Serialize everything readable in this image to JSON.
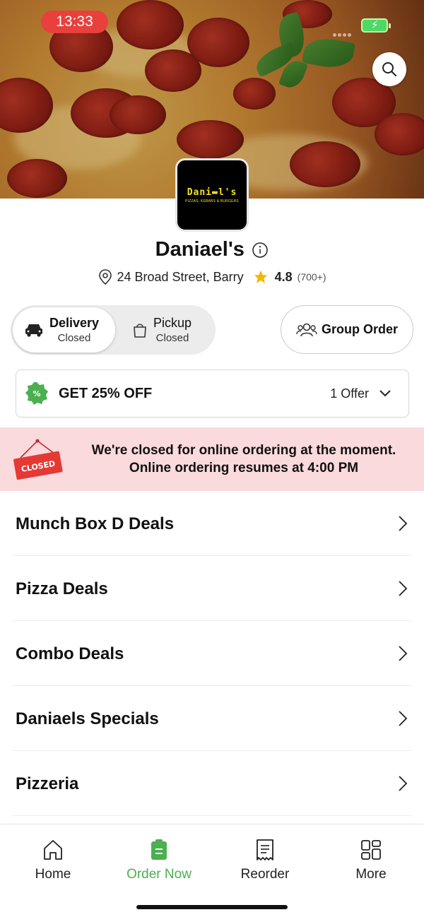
{
  "status_bar": {
    "time": "13:33",
    "battery_icon": "battery-charging-icon"
  },
  "hero": {
    "search_icon": "search-icon"
  },
  "restaurant": {
    "logo_name": "Dani▬l's",
    "logo_tagline": "PIZZAS, KEBABS & BURGERS",
    "name": "Daniael's",
    "address": "24 Broad Street, Barry",
    "rating": "4.8",
    "review_count": "(700+)"
  },
  "fulfillment": {
    "delivery": {
      "label": "Delivery",
      "status": "Closed",
      "selected": true
    },
    "pickup": {
      "label": "Pickup",
      "status": "Closed",
      "selected": false
    }
  },
  "group_order": {
    "label": "Group Order"
  },
  "offer": {
    "title": "GET 25% OFF",
    "count_label": "1 Offer"
  },
  "closed_notice": {
    "sign_text": "CLOSED",
    "line1": "We're closed for online ordering at the moment.",
    "line2": "Online ordering resumes at 4:00 PM"
  },
  "categories": [
    {
      "name": "Munch Box D Deals"
    },
    {
      "name": "Pizza Deals"
    },
    {
      "name": "Combo Deals"
    },
    {
      "name": "Daniaels Specials"
    },
    {
      "name": "Pizzeria"
    }
  ],
  "tabs": [
    {
      "label": "Home",
      "icon": "home-icon",
      "active": false
    },
    {
      "label": "Order Now",
      "icon": "order-icon",
      "active": true
    },
    {
      "label": "Reorder",
      "icon": "receipt-icon",
      "active": false
    },
    {
      "label": "More",
      "icon": "grid-icon",
      "active": false
    }
  ],
  "colors": {
    "accent_green": "#4caf50",
    "status_red": "#e8403d",
    "banner_pink": "#fadadd",
    "star_yellow": "#f5b400"
  }
}
